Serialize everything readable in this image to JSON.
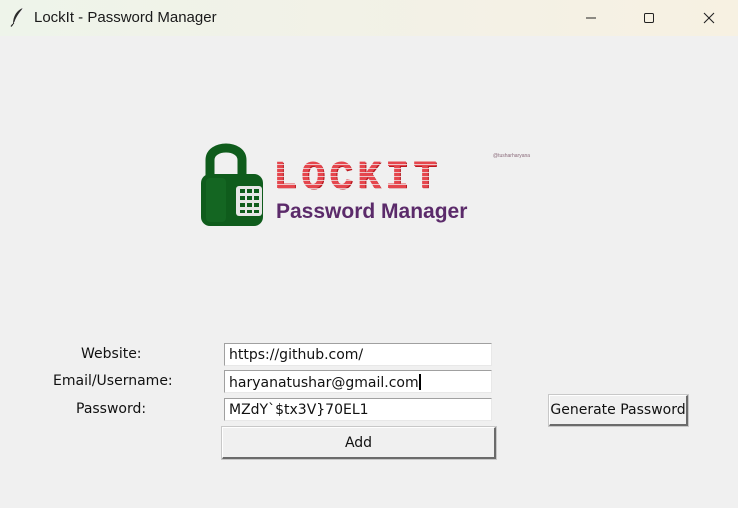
{
  "window": {
    "title": "LockIt - Password Manager",
    "icon": "feather-icon",
    "controls": [
      "minimize-icon",
      "maximize-icon",
      "close-icon"
    ]
  },
  "logo": {
    "wordmark": "LOCKIT",
    "subtitle": "Password Manager",
    "credit": "@tusharharyana",
    "colors": {
      "lock": "#0f5c1c",
      "wordmark": "#e5464d",
      "subtitle": "#5b2a6a"
    }
  },
  "form": {
    "website_label": "Website:",
    "website_value": "https://github.com/",
    "email_label": "Email/Username:",
    "email_value": "haryanatushar@gmail.com",
    "password_label": "Password:",
    "password_value": "MZdY`$tx3V}70EL1",
    "generate_button": "Generate Password",
    "add_button": "Add"
  }
}
